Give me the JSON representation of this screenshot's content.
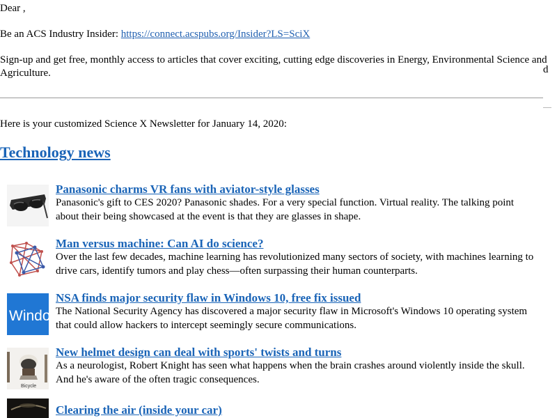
{
  "greeting": "Dear ,",
  "promo": {
    "insider_text": "Be an ACS Industry Insider: ",
    "insider_link": "https://connect.acspubs.org/Insider?LS=SciX",
    "signup_line1": "Sign-up and get free, monthly access to articles that cover exciting, cutting edge discoveries in Energy, Environmental Science and",
    "signup_line2": "Agriculture.",
    "side_letter": "d"
  },
  "intro": "Here is your customized Science X Newsletter for January 14, 2020:",
  "section_title": "Technology news",
  "articles": [
    {
      "title": "Panasonic charms VR fans with aviator-style glasses",
      "desc_line1": "Panasonic's gift to CES 2020? Panasonic shades. For a very special function. Virtual reality. The talking point",
      "desc_line2": "about their being showcased at the event is that they are glasses in shape.",
      "thumb_icon": "vr-glasses-icon"
    },
    {
      "title": "Man versus machine: Can AI do science?",
      "desc_line1": "Over the last few decades, machine learning has revolutionized many sectors of society, with machines learning to",
      "desc_line2": "drive cars, identify tumors and play chess—often surpassing their human counterparts.",
      "thumb_icon": "network-graph-icon"
    },
    {
      "title": "NSA finds major security flaw in Windows 10, free fix issued",
      "desc_line1": "The National Security Agency has discovered a major security flaw in Microsoft's Windows 10 operating system",
      "desc_line2": "that could allow hackers to intercept seemingly secure communications.",
      "thumb_icon": "windows-logo-icon",
      "thumb_text": "Windo"
    },
    {
      "title": "New helmet design can deal with sports' twists and turns",
      "desc_line1": "As a neurologist, Robert Knight has seen what happens when the brain crashes around violently inside the skull.",
      "desc_line2": "And he's aware of the often tragic consequences.",
      "thumb_icon": "helmet-icon",
      "thumb_text": "Bicycle"
    },
    {
      "title": "Clearing the air (inside your car)",
      "desc_line1": "",
      "desc_line2": "",
      "thumb_icon": "car-interior-icon"
    }
  ]
}
